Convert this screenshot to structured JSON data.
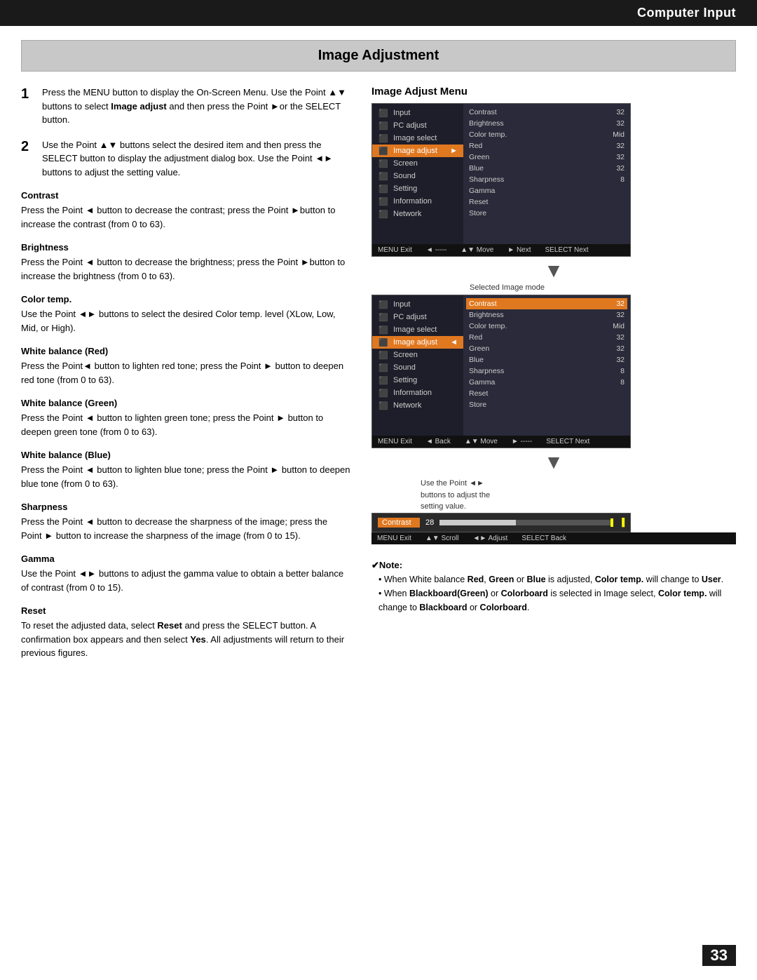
{
  "header": {
    "title": "Computer Input"
  },
  "section": {
    "title": "Image Adjustment"
  },
  "step1": {
    "number": "1",
    "text": "Press the MENU button to display the On-Screen Menu. Use the Point ▲▼ buttons to select Image adjust and then press the Point ►or the SELECT button."
  },
  "step2": {
    "number": "2",
    "text": "Use the Point ▲▼ buttons select the desired item and then press the SELECT button to display the adjustment dialog box. Use the Point ◄► buttons to adjust the setting value."
  },
  "subsections": [
    {
      "title": "Contrast",
      "body": "Press the Point ◄ button to decrease the contrast; press the Point ►button to increase the contrast (from 0 to 63)."
    },
    {
      "title": "Brightness",
      "body": "Press the Point ◄ button to decrease the brightness; press the Point ►button to increase the brightness (from 0 to 63)."
    },
    {
      "title": "Color temp.",
      "body": "Use the Point ◄► buttons to select the desired Color temp. level (XLow, Low, Mid, or High)."
    },
    {
      "title": "White balance (Red)",
      "body": "Press the Point◄ button to lighten red tone; press the Point ► button to deepen red tone (from 0 to 63)."
    },
    {
      "title": "White balance (Green)",
      "body": "Press the Point ◄ button to lighten green tone; press the Point ► button to deepen green tone (from 0 to 63)."
    },
    {
      "title": "White balance (Blue)",
      "body": "Press the Point ◄ button to lighten blue tone; press the Point ► button to deepen blue tone (from 0 to 63)."
    },
    {
      "title": "Sharpness",
      "body": "Press the Point ◄ button to decrease the sharpness of the image; press the Point ► button to increase the sharpness of the image (from 0 to 15)."
    },
    {
      "title": "Gamma",
      "body": "Use the Point ◄► buttons to adjust the gamma value to obtain a better balance of contrast (from 0 to 15)."
    },
    {
      "title": "Reset",
      "body": "To reset the adjusted data, select Reset and press the SELECT button. A confirmation box appears and then select Yes. All adjustments will return to their previous figures."
    }
  ],
  "right": {
    "menu_label": "Image Adjust Menu",
    "selected_image_mode_label": "Selected Image mode",
    "use_point_text": "Use the Point ◄►\nbuttons to adjust the\nsetting value."
  },
  "menu1": {
    "items": [
      {
        "label": "Input",
        "active": false
      },
      {
        "label": "PC adjust",
        "active": false
      },
      {
        "label": "Image select",
        "active": false
      },
      {
        "label": "Image adjust",
        "active": true
      },
      {
        "label": "Screen",
        "active": false
      },
      {
        "label": "Sound",
        "active": false
      },
      {
        "label": "Setting",
        "active": false
      },
      {
        "label": "Information",
        "active": false
      },
      {
        "label": "Network",
        "active": false
      }
    ],
    "right_items": [
      {
        "label": "Contrast",
        "value": "32",
        "active": false
      },
      {
        "label": "Brightness",
        "value": "32",
        "active": false
      },
      {
        "label": "Color temp.",
        "value": "Mid",
        "active": false
      },
      {
        "label": "Red",
        "value": "32",
        "active": false
      },
      {
        "label": "Green",
        "value": "32",
        "active": false
      },
      {
        "label": "Blue",
        "value": "32",
        "active": false
      },
      {
        "label": "Sharpness",
        "value": "8",
        "active": false
      },
      {
        "label": "Gamma",
        "value": "",
        "active": false
      },
      {
        "label": "Reset",
        "value": "",
        "active": false
      },
      {
        "label": "Store",
        "value": "",
        "active": false
      }
    ],
    "footer": [
      "MENU Exit",
      "◄ -----",
      "▲▼ Move",
      "► Next",
      "SELECT Next"
    ]
  },
  "menu2": {
    "items": [
      {
        "label": "Input",
        "active": false
      },
      {
        "label": "PC adjust",
        "active": false
      },
      {
        "label": "Image select",
        "active": false
      },
      {
        "label": "Image adjust",
        "active": true
      },
      {
        "label": "Screen",
        "active": false
      },
      {
        "label": "Sound",
        "active": false
      },
      {
        "label": "Setting",
        "active": false
      },
      {
        "label": "Information",
        "active": false
      },
      {
        "label": "Network",
        "active": false
      }
    ],
    "right_items": [
      {
        "label": "Contrast",
        "value": "32",
        "active": true
      },
      {
        "label": "Brightness",
        "value": "32",
        "active": false
      },
      {
        "label": "Color temp.",
        "value": "Mid",
        "active": false
      },
      {
        "label": "Red",
        "value": "32",
        "active": false
      },
      {
        "label": "Green",
        "value": "32",
        "active": false
      },
      {
        "label": "Blue",
        "value": "32",
        "active": false
      },
      {
        "label": "Sharpness",
        "value": "8",
        "active": false
      },
      {
        "label": "Gamma",
        "value": "8",
        "active": false
      },
      {
        "label": "Reset",
        "value": "",
        "active": false
      },
      {
        "label": "Store",
        "value": "",
        "active": false
      }
    ],
    "footer": [
      "MENU Exit",
      "◄ Back",
      "▲▼ Move",
      "► -----",
      "SELECT Next"
    ]
  },
  "note": {
    "title": "✔Note:",
    "bullets": [
      "When White balance Red, Green or Blue is adjusted, Color temp. will change to User.",
      "When Blackboard(Green) or Colorboard is selected in Image select, Color temp. will change to Blackboard or Colorboard."
    ]
  },
  "page_number": "33"
}
